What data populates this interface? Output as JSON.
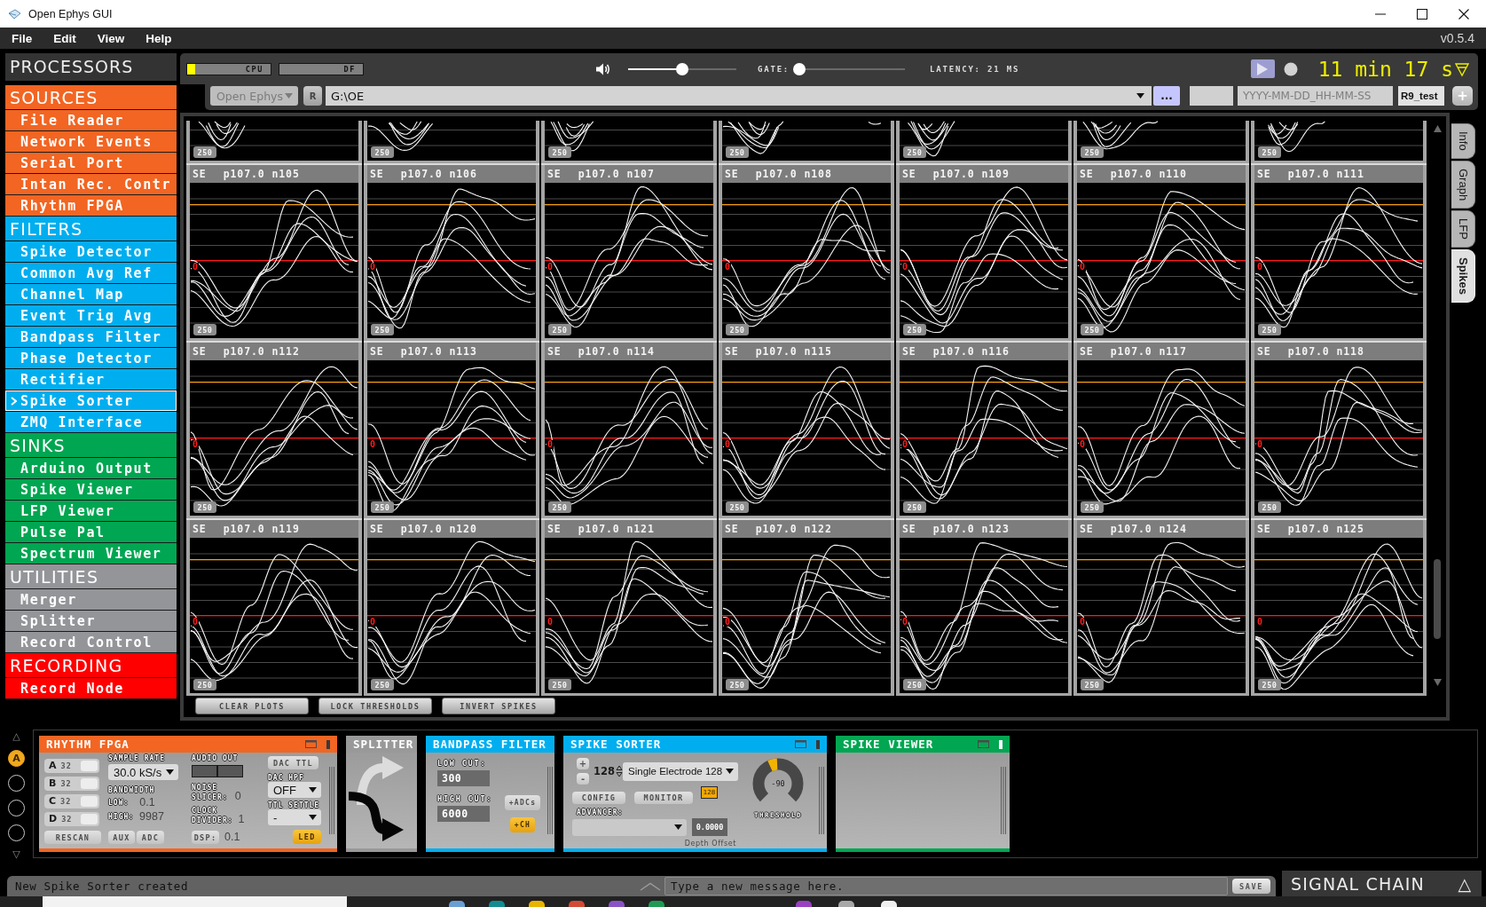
{
  "window": {
    "title": "Open Ephys GUI"
  },
  "menu": {
    "items": [
      "File",
      "Edit",
      "View",
      "Help"
    ],
    "version": "v0.5.4"
  },
  "sidebar": {
    "title": "PROCESSORS",
    "categories": [
      {
        "name": "SOURCES",
        "color": "#f26522",
        "items": [
          {
            "label": "File Reader",
            "selected": false
          },
          {
            "label": "Network Events",
            "selected": false
          },
          {
            "label": "Serial Port",
            "selected": false
          },
          {
            "label": "Intan Rec. Contr",
            "selected": false
          },
          {
            "label": "Rhythm FPGA",
            "selected": false
          }
        ]
      },
      {
        "name": "FILTERS",
        "color": "#00aeef",
        "items": [
          {
            "label": "Spike Detector",
            "selected": false
          },
          {
            "label": "Common Avg Ref",
            "selected": false
          },
          {
            "label": "Channel Map",
            "selected": false
          },
          {
            "label": "Event Trig Avg",
            "selected": false
          },
          {
            "label": "Bandpass Filter",
            "selected": false
          },
          {
            "label": "Phase Detector",
            "selected": false
          },
          {
            "label": "Rectifier",
            "selected": false
          },
          {
            "label": "Spike Sorter",
            "selected": true
          },
          {
            "label": "ZMQ Interface",
            "selected": false
          }
        ]
      },
      {
        "name": "SINKS",
        "color": "#00a651",
        "items": [
          {
            "label": "Arduino Output",
            "selected": false
          },
          {
            "label": "Spike Viewer",
            "selected": false
          },
          {
            "label": "LFP Viewer",
            "selected": false
          },
          {
            "label": "Pulse Pal",
            "selected": false
          },
          {
            "label": "Spectrum Viewer",
            "selected": false
          }
        ]
      },
      {
        "name": "UTILITIES",
        "color": "#939598",
        "items": [
          {
            "label": "Merger",
            "selected": false
          },
          {
            "label": "Splitter",
            "selected": false
          },
          {
            "label": "Record Control",
            "selected": false
          }
        ]
      },
      {
        "name": "RECORDING",
        "color": "#ff0000",
        "items": [
          {
            "label": "Record Node",
            "selected": false
          }
        ]
      }
    ]
  },
  "control_panel": {
    "meters": [
      {
        "label": "CPU",
        "level": 0.1
      },
      {
        "label": "DF"
      }
    ],
    "volume": {
      "level": 0.5
    },
    "gate": {
      "label": "GATE:",
      "level": 0
    },
    "latency": "LATENCY: 21 MS",
    "acquiring": true,
    "recording": false,
    "clock": "11 min 17 s",
    "engine": {
      "value": "Open Ephys",
      "disabled": true
    },
    "reset_button": "R",
    "directory": "G:\\OE",
    "browse_button": "...",
    "filename_fields": [
      {
        "placeholder": "YYYY-MM-DD_HH-MM-SS"
      },
      {
        "value": "R9_test"
      }
    ],
    "add_button": "+"
  },
  "canvas": {
    "partial_panels": [
      {
        "scale_label": "250"
      },
      {
        "scale_label": "250"
      },
      {
        "scale_label": "250"
      },
      {
        "scale_label": "250"
      },
      {
        "scale_label": "250"
      },
      {
        "scale_label": "250"
      },
      {
        "scale_label": "250"
      }
    ],
    "panels": [
      {
        "electrode_type": "SE",
        "name": "p107.0 n105",
        "zero_label": "0",
        "scale_label": "250"
      },
      {
        "electrode_type": "SE",
        "name": "p107.0 n106",
        "zero_label": "0",
        "scale_label": "250"
      },
      {
        "electrode_type": "SE",
        "name": "p107.0 n107",
        "zero_label": "0",
        "scale_label": "250"
      },
      {
        "electrode_type": "SE",
        "name": "p107.0 n108",
        "zero_label": "0",
        "scale_label": "250"
      },
      {
        "electrode_type": "SE",
        "name": "p107.0 n109",
        "zero_label": "0",
        "scale_label": "250"
      },
      {
        "electrode_type": "SE",
        "name": "p107.0 n110",
        "zero_label": "0",
        "scale_label": "250"
      },
      {
        "electrode_type": "SE",
        "name": "p107.0 n111",
        "zero_label": "0",
        "scale_label": "250"
      },
      {
        "electrode_type": "SE",
        "name": "p107.0 n112",
        "zero_label": "0",
        "scale_label": "250"
      },
      {
        "electrode_type": "SE",
        "name": "p107.0 n113",
        "zero_label": "0",
        "scale_label": "250"
      },
      {
        "electrode_type": "SE",
        "name": "p107.0 n114",
        "zero_label": "0",
        "scale_label": "250"
      },
      {
        "electrode_type": "SE",
        "name": "p107.0 n115",
        "zero_label": "0",
        "scale_label": "250"
      },
      {
        "electrode_type": "SE",
        "name": "p107.0 n116",
        "zero_label": "0",
        "scale_label": "250"
      },
      {
        "electrode_type": "SE",
        "name": "p107.0 n117",
        "zero_label": "0",
        "scale_label": "250"
      },
      {
        "electrode_type": "SE",
        "name": "p107.0 n118",
        "zero_label": "0",
        "scale_label": "250"
      },
      {
        "electrode_type": "SE",
        "name": "p107.0 n119",
        "zero_label": "0",
        "scale_label": "250"
      },
      {
        "electrode_type": "SE",
        "name": "p107.0 n120",
        "zero_label": "0",
        "scale_label": "250"
      },
      {
        "electrode_type": "SE",
        "name": "p107.0 n121",
        "zero_label": "0",
        "scale_label": "250"
      },
      {
        "electrode_type": "SE",
        "name": "p107.0 n122",
        "zero_label": "0",
        "scale_label": "250"
      },
      {
        "electrode_type": "SE",
        "name": "p107.0 n123",
        "zero_label": "0",
        "scale_label": "250"
      },
      {
        "electrode_type": "SE",
        "name": "p107.0 n124",
        "zero_label": "0",
        "scale_label": "250"
      },
      {
        "electrode_type": "SE",
        "name": "p107.0 n125",
        "zero_label": "0",
        "scale_label": "250"
      }
    ],
    "buttons": [
      "CLEAR PLOTS",
      "LOCK THRESHOLDS",
      "INVERT SPIKES"
    ]
  },
  "visualizer_tabs": [
    {
      "label": "Info",
      "selected": false
    },
    {
      "label": "Graph",
      "selected": false
    },
    {
      "label": "LFP",
      "selected": false
    },
    {
      "label": "Spikes",
      "selected": true
    }
  ],
  "editor_viewport": {
    "scroll_up": "△",
    "scroll_down": "▽",
    "slots": [
      {
        "label": "A",
        "selected": true
      },
      {
        "selected": false
      },
      {
        "selected": false
      },
      {
        "selected": false
      }
    ],
    "editors": [
      {
        "kind": "rhythm_fpga",
        "title": "RHYTHM FPGA",
        "color": "#f26522",
        "tab_open": false,
        "headstages": [
          {
            "port": "A",
            "channels": "32"
          },
          {
            "port": "B",
            "channels": "32"
          },
          {
            "port": "C",
            "channels": "32"
          },
          {
            "port": "D",
            "channels": "32"
          }
        ],
        "rescan_button": "RESCAN",
        "sample_rate": {
          "label": "SAMPLE RATE",
          "value": "30.0 kS/s"
        },
        "bandwidth": {
          "label": "BANDWIDTH",
          "low_label": "LOW:",
          "low": "0.1",
          "high_label": "HIGH:",
          "high": "9987"
        },
        "aux": {
          "label": "AUX",
          "on": false
        },
        "adc": {
          "label": "ADC",
          "on": false
        },
        "audio_out": {
          "label": "AUDIO OUT",
          "channels": [
            {
              "on": false
            },
            {
              "on": false
            }
          ]
        },
        "noise_slicer": {
          "label": "NOISE SLICER:",
          "value": "0"
        },
        "clock_divider": {
          "label": "CLOCK DIVIDER:",
          "value": "1"
        },
        "dsp": {
          "label": "DSP:",
          "on": false,
          "value": "0.1"
        },
        "dac_ttl_button": "DAC TTL",
        "dac_hpf": {
          "label": "DAC HPF",
          "value": "OFF"
        },
        "ttl_settle": {
          "label": "TTL SETTLE",
          "value": "-"
        },
        "led": {
          "label": "LED",
          "on": true
        }
      },
      {
        "kind": "splitter",
        "title": "SPLITTER",
        "color": "#999999",
        "paths": [
          {
            "selected": false
          },
          {
            "selected": true
          }
        ]
      },
      {
        "kind": "bandpass_filter",
        "title": "BANDPASS FILTER",
        "color": "#00aeef",
        "low_cut": {
          "label": "LOW CUT:",
          "value": "300"
        },
        "high_cut": {
          "label": "HIGH CUT:",
          "value": "6000"
        },
        "toggles": [
          {
            "label": "+ADCs",
            "on": false
          },
          {
            "label": "+CH",
            "on": true
          }
        ]
      },
      {
        "kind": "spike_sorter",
        "title": "SPIKE SORTER",
        "color": "#00aeef",
        "tab_open": false,
        "add_button": "+",
        "remove_button": "-",
        "electrode_count": "128",
        "electrode_type": "Single Electrode 128",
        "config_button": "CONFIG",
        "monitor_button": "MONITOR",
        "channel_badge": "128",
        "advancer_label": "ADVANCER:",
        "depth_offset": {
          "value": "0.0000",
          "label": "Depth Offset"
        },
        "threshold": {
          "value": "-90",
          "label": "THRESHOLD",
          "level": 0.45
        }
      },
      {
        "kind": "spike_viewer",
        "title": "SPIKE VIEWER",
        "color": "#00a651",
        "tab_open": true
      }
    ]
  },
  "status_bar": {
    "message": "New Spike Sorter created",
    "input_placeholder": "Type a new message here.",
    "save_button": "SAVE"
  },
  "signal_chain": {
    "label": "SIGNAL CHAIN",
    "toggle": "△"
  },
  "taskbar": {
    "apps": [
      {
        "color": "#6a9fd4"
      },
      {
        "color": "#138b8f"
      },
      {
        "color": "#e8b400"
      },
      {
        "color": "#d24a36"
      },
      {
        "color": "#8b52c4"
      },
      {
        "color": "#1f9a52"
      },
      {
        "color": "#9a40c0"
      },
      {
        "color": "#a8a8a8"
      },
      {
        "color": "#f0f0f0"
      }
    ]
  }
}
